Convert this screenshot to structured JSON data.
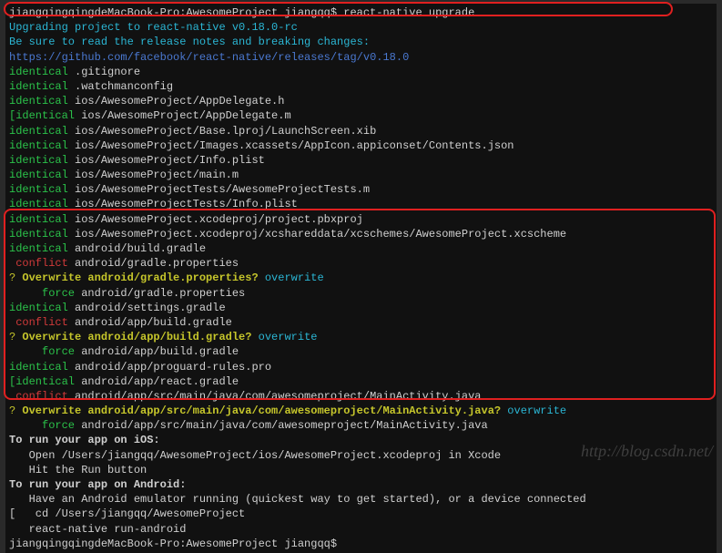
{
  "prompt1_host": "jiangqingqingdeMacBook-Pro:AwesomeProject jiangqq$ ",
  "prompt1_cmd": "react-native upgrade",
  "upgrade_line": "Upgrading project to react-native v0.18.0-rc",
  "notes_line": "Be sure to read the release notes and breaking changes:",
  "release_url": "https://github.com/facebook/react-native/releases/tag/v0.18.0",
  "id": "identical",
  "idb": "[identical",
  "conflict": " conflict",
  "force": "     force",
  "q": "?",
  "ow_prompt": " overwrite",
  "files": {
    "gitignore": " .gitignore",
    "watchman": " .watchmanconfig",
    "appdelegate_h": " ios/AwesomeProject/AppDelegate.h",
    "appdelegate_m": " ios/AwesomeProject/AppDelegate.m",
    "launch": " ios/AwesomeProject/Base.lproj/LaunchScreen.xib",
    "appicon": " ios/AwesomeProject/Images.xcassets/AppIcon.appiconset/Contents.json",
    "infoplist": " ios/AwesomeProject/Info.plist",
    "mainm": " ios/AwesomeProject/main.m",
    "tests_m": " ios/AwesomeProjectTests/AwesomeProjectTests.m",
    "tests_info": " ios/AwesomeProjectTests/Info.plist",
    "pbxproj": " ios/AwesomeProject.xcodeproj/project.pbxproj",
    "xcscheme": " ios/AwesomeProject.xcodeproj/xcshareddata/xcschemes/AwesomeProject.xcscheme",
    "andr_build": " android/build.gradle",
    "andr_gradle_props": " android/gradle.properties",
    "andr_settings": " android/settings.gradle",
    "andr_app_build": " android/app/build.gradle",
    "andr_proguard": " android/app/proguard-rules.pro",
    "andr_react_gradle": " android/app/react.gradle",
    "mainactivity": " android/app/src/main/java/com/awesomeproject/MainActivity.java"
  },
  "ow_q1": " Overwrite android/gradle.properties?",
  "ow_q2": " Overwrite android/app/build.gradle?",
  "ow_q3": " Overwrite android/app/src/main/java/com/awesomeproject/MainActivity.java?",
  "run_ios_header": "To run your app on iOS:",
  "run_ios_1": "   Open /Users/jiangqq/AwesomeProject/ios/AwesomeProject.xcodeproj in Xcode",
  "run_ios_2": "   Hit the Run button",
  "run_andr_header": "To run your app on Android:",
  "run_andr_1": "   Have an Android emulator running (quickest way to get started), or a device connected",
  "run_andr_2": "[   cd /Users/jiangqq/AwesomeProject",
  "run_andr_3": "   react-native run-android",
  "prompt2": "jiangqingqingdeMacBook-Pro:AwesomeProject jiangqq$",
  "watermark": "http://blog.csdn.net/"
}
